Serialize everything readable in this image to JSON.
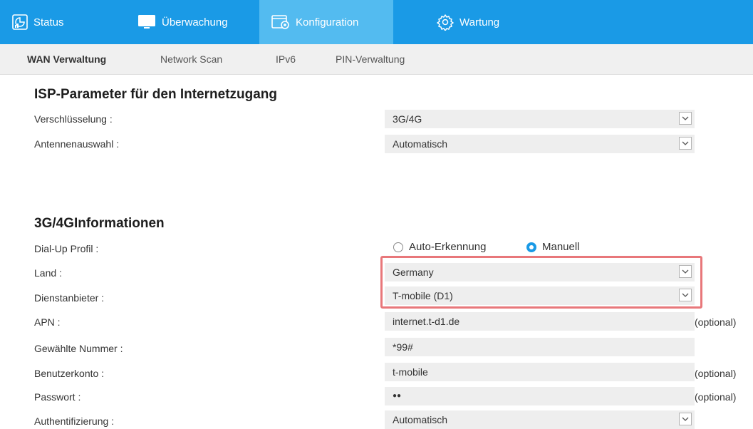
{
  "colors": {
    "accent": "#1a9ae6",
    "active_tab": "#53bbf0",
    "highlight": "#e8777a",
    "field_bg": "#eeeeee"
  },
  "top_nav": {
    "tabs": [
      {
        "label": "Status",
        "icon": "status-chart-icon"
      },
      {
        "label": "Überwachung",
        "icon": "monitor-icon"
      },
      {
        "label": "Konfiguration",
        "icon": "configuration-icon",
        "active": true
      },
      {
        "label": "Wartung",
        "icon": "gear-icon"
      }
    ]
  },
  "sub_nav": {
    "tabs": [
      {
        "label": "WAN Verwaltung",
        "active": true
      },
      {
        "label": "Network Scan"
      },
      {
        "label": "IPv6"
      },
      {
        "label": "PIN-Verwaltung"
      }
    ]
  },
  "isp": {
    "title": "ISP-Parameter für den Internetzugang",
    "encryption": {
      "label": "Verschlüsselung :",
      "value": "3G/4G"
    },
    "antenna": {
      "label": "Antennenauswahl :",
      "value": "Automatisch"
    }
  },
  "info": {
    "title": "3G/4GInformationen",
    "dialup": {
      "label": "Dial-Up Profil :",
      "options": [
        {
          "label": "Auto-Erkennung",
          "selected": false
        },
        {
          "label": "Manuell",
          "selected": true
        }
      ]
    },
    "country": {
      "label": "Land :",
      "value": "Germany"
    },
    "provider": {
      "label": "Dienstanbieter :",
      "value": "T-mobile (D1)"
    },
    "apn": {
      "label": "APN :",
      "value": "internet.t-d1.de",
      "note": "(optional)"
    },
    "number": {
      "label": "Gewählte Nummer :",
      "value": "*99#"
    },
    "account": {
      "label": "Benutzerkonto :",
      "value": "t-mobile",
      "note": "(optional)"
    },
    "password": {
      "label": "Passwort :",
      "value": "●●",
      "note": "(optional)"
    },
    "auth": {
      "label": "Authentifizierung :",
      "value": "Automatisch"
    }
  }
}
